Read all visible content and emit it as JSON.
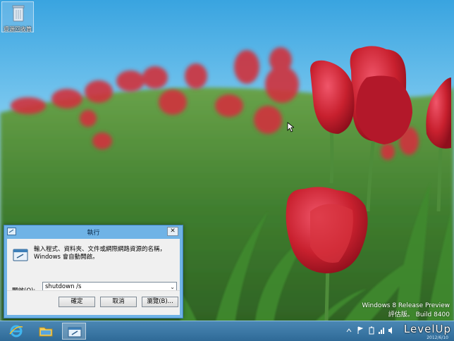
{
  "desktop": {
    "recycle_bin_label": "資源回收筒"
  },
  "run_dialog": {
    "title": "執行",
    "close_glyph": "✕",
    "description": "輸入程式、資料夾、文件或網際網路資源的名稱，Windows 會自動開啟。",
    "open_label": "開啟(O):",
    "command_value": "shutdown /s",
    "ok_label": "確定",
    "cancel_label": "取消",
    "browse_label": "瀏覽(B)..."
  },
  "watermark": {
    "line1": "Windows 8 Release Preview",
    "line2": "評估版。 Build 8400"
  },
  "taskbar": {
    "apps": [
      "internet-explorer-icon",
      "file-explorer-icon",
      "run-icon"
    ],
    "overlay_brand": "LevelUp",
    "overlay_date": "2012/6/10"
  },
  "colors": {
    "sky": "#5fb6e6",
    "tulip": "#c8202e",
    "dialog_border": "#6fb3e6",
    "taskbar": "#3b78a6"
  }
}
